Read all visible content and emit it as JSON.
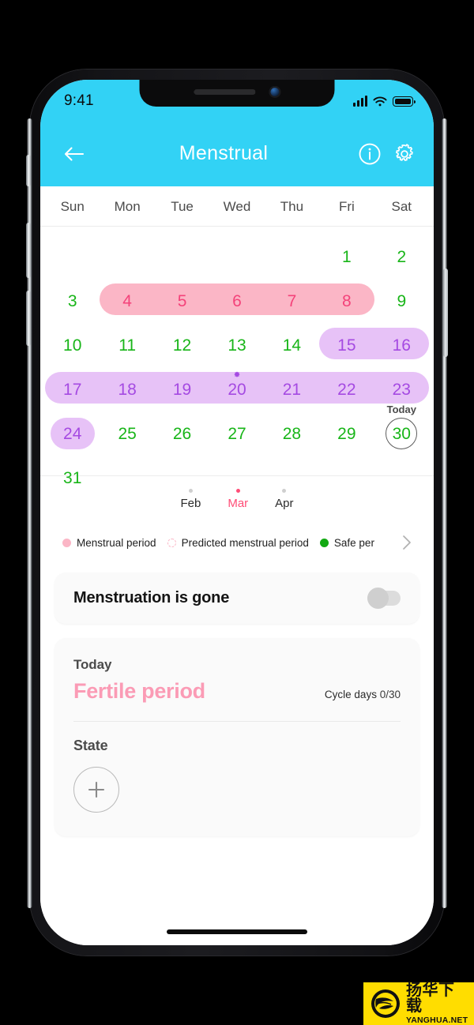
{
  "status_bar": {
    "time": "9:41",
    "icons": [
      "signal-bars-icon",
      "wifi-icon",
      "battery-icon"
    ]
  },
  "header": {
    "title": "Menstrual",
    "back_icon": "back-arrow-icon",
    "info_icon": "info-circle-icon",
    "settings_icon": "gear-icon"
  },
  "calendar": {
    "weekdays": [
      "Sun",
      "Mon",
      "Tue",
      "Wed",
      "Thu",
      "Fri",
      "Sat"
    ],
    "weeks": [
      [
        {
          "label": "",
          "type": "empty"
        },
        {
          "label": "",
          "type": "empty"
        },
        {
          "label": "",
          "type": "empty"
        },
        {
          "label": "",
          "type": "empty"
        },
        {
          "label": "",
          "type": "empty"
        },
        {
          "label": "1",
          "type": "safe"
        },
        {
          "label": "2",
          "type": "safe"
        }
      ],
      [
        {
          "label": "3",
          "type": "safe"
        },
        {
          "label": "4",
          "type": "menstrual"
        },
        {
          "label": "5",
          "type": "menstrual"
        },
        {
          "label": "6",
          "type": "menstrual"
        },
        {
          "label": "7",
          "type": "menstrual"
        },
        {
          "label": "8",
          "type": "menstrual"
        },
        {
          "label": "9",
          "type": "safe"
        }
      ],
      [
        {
          "label": "10",
          "type": "safe"
        },
        {
          "label": "11",
          "type": "safe"
        },
        {
          "label": "12",
          "type": "safe"
        },
        {
          "label": "13",
          "type": "safe"
        },
        {
          "label": "14",
          "type": "safe"
        },
        {
          "label": "15",
          "type": "fertile"
        },
        {
          "label": "16",
          "type": "fertile"
        }
      ],
      [
        {
          "label": "17",
          "type": "fertile"
        },
        {
          "label": "18",
          "type": "fertile"
        },
        {
          "label": "19",
          "type": "fertile"
        },
        {
          "label": "20",
          "type": "fertile",
          "ovulation": true
        },
        {
          "label": "21",
          "type": "fertile"
        },
        {
          "label": "22",
          "type": "fertile"
        },
        {
          "label": "23",
          "type": "fertile"
        }
      ],
      [
        {
          "label": "24",
          "type": "fertile",
          "pill": true
        },
        {
          "label": "25",
          "type": "safe"
        },
        {
          "label": "26",
          "type": "safe"
        },
        {
          "label": "27",
          "type": "safe"
        },
        {
          "label": "28",
          "type": "safe"
        },
        {
          "label": "29",
          "type": "safe"
        },
        {
          "label": "30",
          "type": "safe",
          "today": true,
          "today_label": "Today"
        }
      ],
      [
        {
          "label": "31",
          "type": "safe"
        },
        {
          "label": "",
          "type": "empty"
        },
        {
          "label": "",
          "type": "empty"
        },
        {
          "label": "",
          "type": "empty"
        },
        {
          "label": "",
          "type": "empty"
        },
        {
          "label": "",
          "type": "empty"
        },
        {
          "label": "",
          "type": "empty"
        }
      ]
    ],
    "bands": [
      {
        "week": 1,
        "start": 1,
        "end": 5,
        "kind": "menstrual"
      },
      {
        "week": 2,
        "start": 5,
        "end": 6,
        "kind": "fertile"
      },
      {
        "week": 3,
        "start": 0,
        "end": 6,
        "kind": "fertile"
      }
    ]
  },
  "month_switcher": {
    "months": [
      {
        "name": "Feb",
        "active": false
      },
      {
        "name": "Mar",
        "active": true
      },
      {
        "name": "Apr",
        "active": false
      }
    ]
  },
  "legend": {
    "items": [
      {
        "label": "Menstrual period",
        "marker": "solid",
        "color": "#FBB6C6"
      },
      {
        "label": "Predicted menstrual period",
        "marker": "ring",
        "color": "#FBB6C6"
      },
      {
        "label": "Safe per",
        "marker": "solid",
        "color": "#12A912"
      }
    ],
    "chevron_icon": "chevron-right-icon"
  },
  "toggle_card": {
    "label": "Menstruation is gone",
    "switch_on": false
  },
  "status_card": {
    "today_label": "Today",
    "phase_name": "Fertile period",
    "cycle_days_label": "Cycle days",
    "cycle_days_value": "0/30",
    "state_label": "State",
    "add_icon": "plus-icon"
  },
  "watermark": {
    "cn": "扬华下载",
    "en": "YANGHUA.NET",
    "logo_icon": "globe-logo-icon",
    "background": "#FFDD00"
  },
  "colors": {
    "header_cyan": "#32D2F5",
    "menstrual_band": "#FBB6C6",
    "menstrual_text": "#F4437A",
    "fertile_band": "#E7C2F7",
    "fertile_text": "#A54AE2",
    "safe_text": "#18B518",
    "accent_pink": "#FF4D77"
  }
}
